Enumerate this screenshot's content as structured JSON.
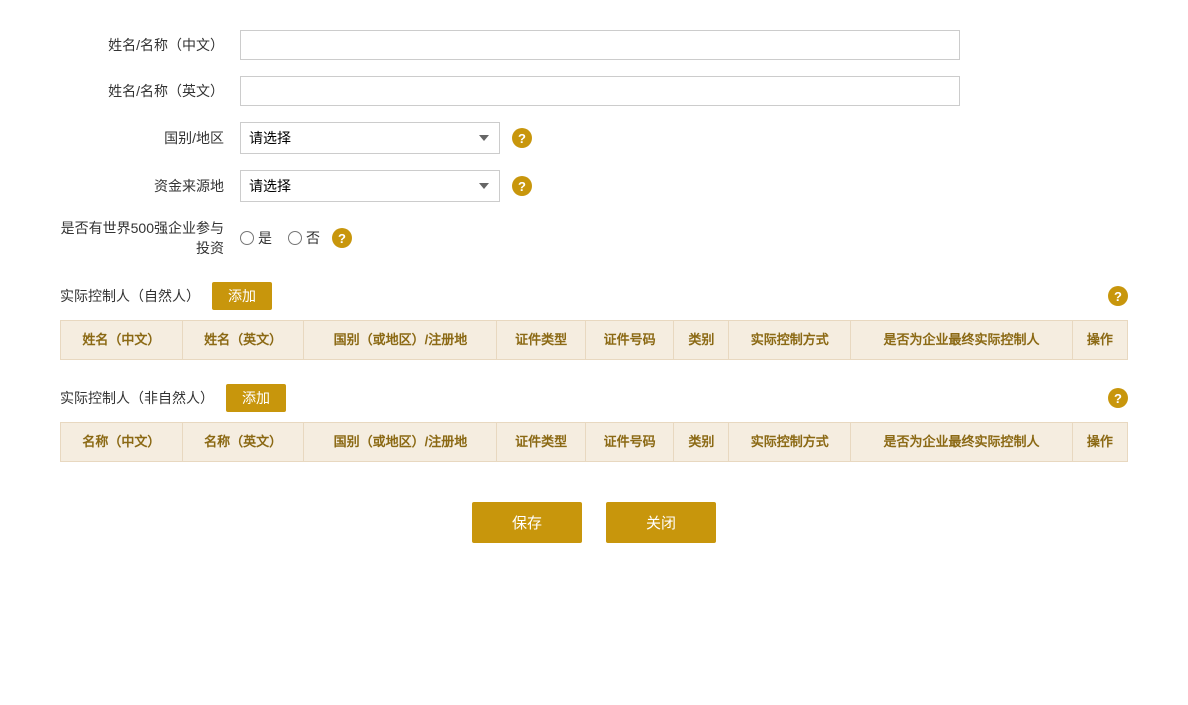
{
  "form": {
    "name_cn_label": "姓名/名称（中文）",
    "name_en_label": "姓名/名称（英文）",
    "country_label": "国别/地区",
    "country_placeholder": "请选择",
    "fund_source_label": "资金来源地",
    "fund_source_placeholder": "请选择",
    "world500_label": "是否有世界500强企业参与投资",
    "radio_yes": "是",
    "radio_no": "否",
    "help_icon_text": "?"
  },
  "natural_person_section": {
    "title": "实际控制人（自然人）",
    "add_btn": "添加",
    "columns": [
      "姓名（中文）",
      "姓名（英文）",
      "国别（或地区）/注册地",
      "证件类型",
      "证件号码",
      "类别",
      "实际控制方式",
      "是否为企业最终实际控制人",
      "操作"
    ]
  },
  "non_natural_person_section": {
    "title": "实际控制人（非自然人）",
    "add_btn": "添加",
    "columns": [
      "名称（中文）",
      "名称（英文）",
      "国别（或地区）/注册地",
      "证件类型",
      "证件号码",
      "类别",
      "实际控制方式",
      "是否为企业最终实际控制人",
      "操作"
    ]
  },
  "actions": {
    "save_label": "保存",
    "close_label": "关闭"
  }
}
